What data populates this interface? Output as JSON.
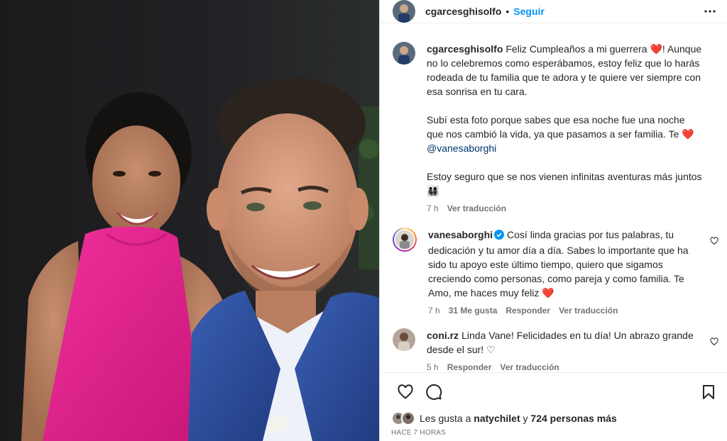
{
  "post": {
    "author": "cgarcesghisolfo",
    "follow_label": "Seguir",
    "separator": "•"
  },
  "comments": [
    {
      "user": "cgarcesghisolfo",
      "text_1": "Feliz Cumpleaños a mi guerrera ❤️! Aunque no lo celebremos como esperábamos, estoy feliz que lo harás rodeada de tu familia que te adora y te quiere ver siempre con esa sonrisa en tu cara.",
      "text_2": "Subí esta foto porque sabes que esa noche fue una noche que nos cambió la vida, ya que pasamos a ser familia. Te ❤️",
      "mention": "@vanesaborghi",
      "text_3": "Estoy seguro que se nos vienen infinitas aventuras más juntos 👨‍👩‍👧‍👦",
      "time": "7 h",
      "translate": "Ver traducción"
    },
    {
      "user": "vanesaborghi",
      "verified": true,
      "text": "Cosí linda gracias por tus palabras, tu dedicación y tu amor día a día. Sabes lo importante que ha sido tu apoyo este último tiempo, quiero que sigamos creciendo como personas, como pareja y como familia. Te Amo, me haces muy feliz ❤️",
      "time": "7 h",
      "likes": "31 Me gusta",
      "reply": "Responder",
      "translate": "Ver traducción"
    },
    {
      "user": "coni.rz",
      "text": "Linda Vane! Felicidades en tu día! Un abrazo grande desde el sur! ♡",
      "time": "5 h",
      "reply": "Responder",
      "translate": "Ver traducción"
    }
  ],
  "likes_line": {
    "prefix": "Les gusta a",
    "user": "natychilet",
    "conj": "y",
    "others": "724 personas más"
  },
  "timestamp": "HACE 7 HORAS",
  "icons": [
    "heart-icon",
    "comment-icon",
    "bookmark-icon",
    "more-icon",
    "verified-icon"
  ],
  "colors": {
    "accent": "#0095f6",
    "heart": "#ed4956",
    "text": "#262626",
    "muted": "#737373",
    "dress": "#e0208a",
    "suit": "#2e4d9a"
  }
}
